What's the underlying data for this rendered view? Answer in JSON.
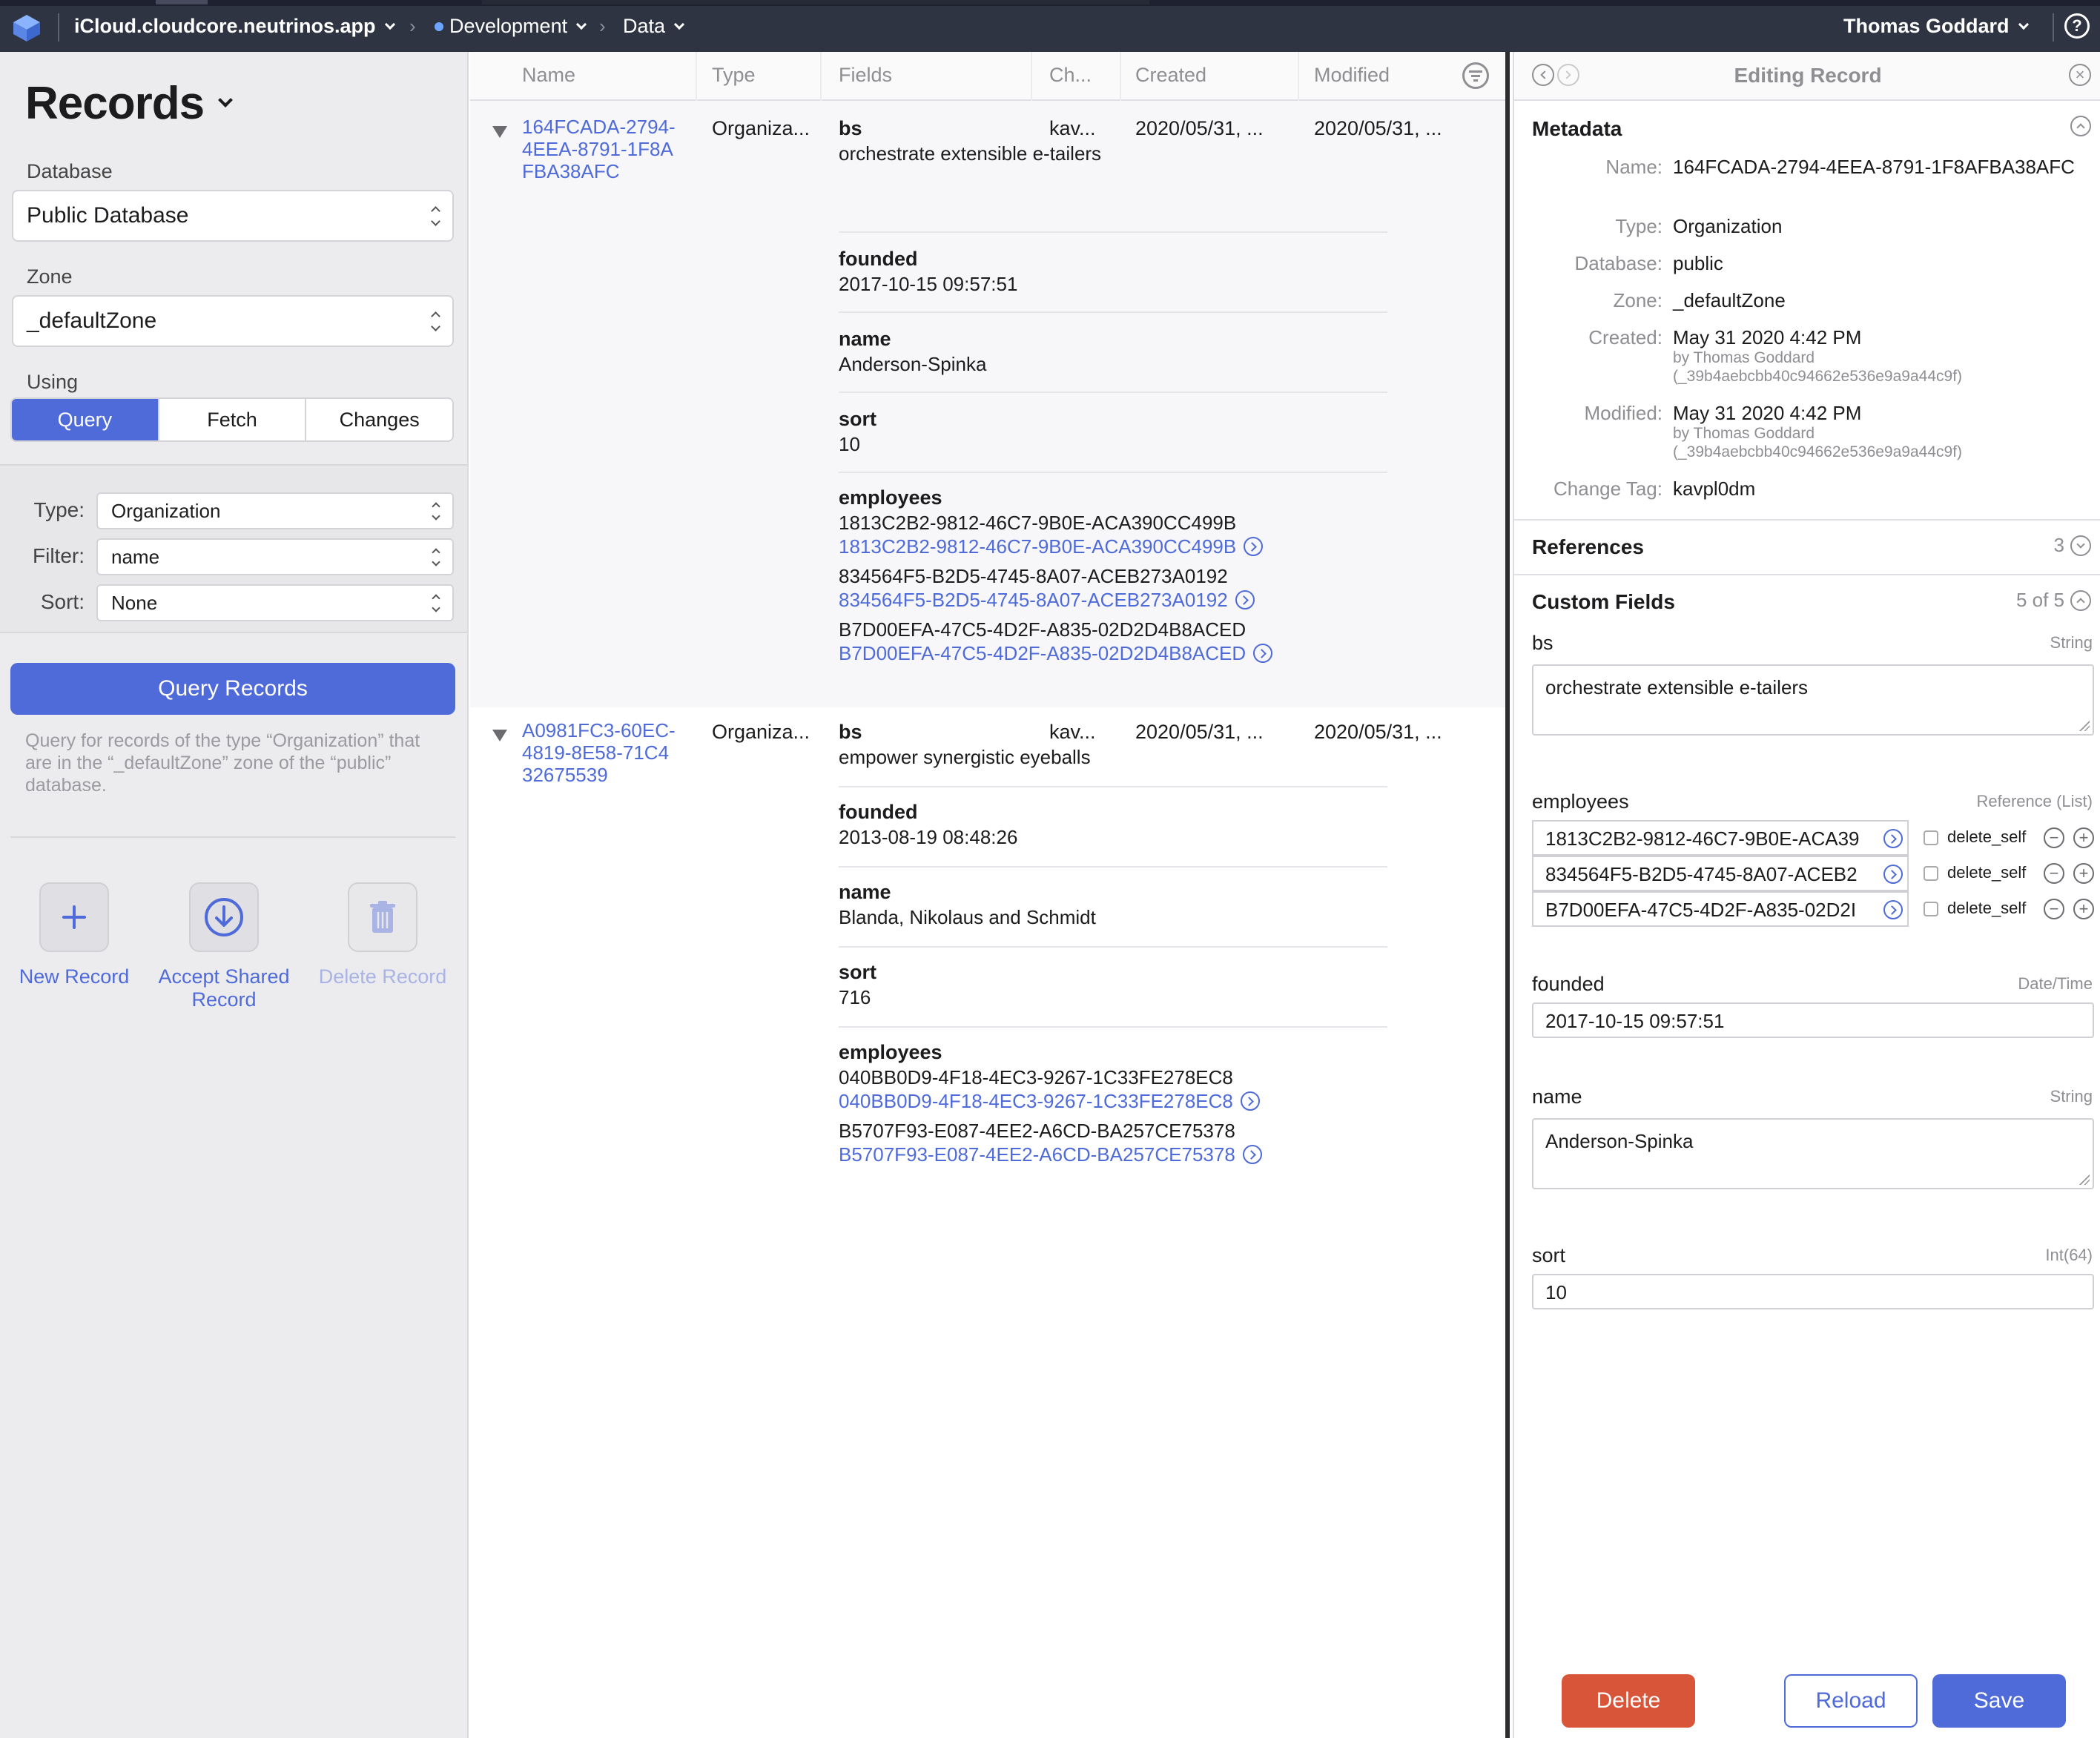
{
  "topbar": {
    "account": "iCloud.cloudcore.neutrinos.app",
    "environment": "Development",
    "section": "Data",
    "user": "Thomas Goddard",
    "help_icon": "?"
  },
  "sidebar": {
    "title": "Records",
    "database_label": "Database",
    "database_value": "Public Database",
    "zone_label": "Zone",
    "zone_value": "_defaultZone",
    "using_label": "Using",
    "modes": [
      "Query",
      "Fetch",
      "Changes"
    ],
    "active_mode": "Query",
    "type_label": "Type:",
    "type_value": "Organization",
    "filter_label": "Filter:",
    "filter_value": "name",
    "sort_label": "Sort:",
    "sort_value": "None",
    "query_button": "Query Records",
    "query_description": "Query for records of the type “Organization” that are in the “_defaultZone” zone of the “public” database.",
    "actions": {
      "new": "New Record",
      "accept": "Accept Shared Record",
      "delete": "Delete Record"
    },
    "accent_color": "#4f6ad9"
  },
  "table": {
    "columns": {
      "name": "Name",
      "type": "Type",
      "fields": "Fields",
      "change_tag": "Ch...",
      "created": "Created",
      "modified": "Modified"
    },
    "records": [
      {
        "name": "164FCADA-2794-4EEA-8791-1F8AFBA38AFC",
        "type": "Organiza...",
        "change_tag": "kav...",
        "created": "2020/05/31, ...",
        "modified": "2020/05/31, ...",
        "bs_label": "bs",
        "bs": "orchestrate extensible e-tailers",
        "founded_label": "founded",
        "founded": "2017-10-15 09:57:51",
        "name_label": "name",
        "name_value": "Anderson-Spinka",
        "sort_label": "sort",
        "sort": "10",
        "employees_label": "employees",
        "employees": [
          "1813C2B2-9812-46C7-9B0E-ACA390CC499B",
          "834564F5-B2D5-4745-8A07-ACEB273A0192",
          "B7D00EFA-47C5-4D2F-A835-02D2D4B8ACED"
        ]
      },
      {
        "name": "A0981FC3-60EC-4819-8E58-71C432675539",
        "type": "Organiza...",
        "change_tag": "kav...",
        "created": "2020/05/31, ...",
        "modified": "2020/05/31, ...",
        "bs_label": "bs",
        "bs": "empower synergistic eyeballs",
        "founded_label": "founded",
        "founded": "2013-08-19 08:48:26",
        "name_label": "name",
        "name_value": "Blanda, Nikolaus and Schmidt",
        "sort_label": "sort",
        "sort": "716",
        "employees_label": "employees",
        "employees": [
          "040BB0D9-4F18-4EC3-9267-1C33FE278EC8",
          "B5707F93-E087-4EE2-A6CD-BA257CE75378"
        ]
      }
    ]
  },
  "editor": {
    "title": "Editing Record",
    "metadata_title": "Metadata",
    "meta": {
      "name_label": "Name:",
      "name": "164FCADA-2794-4EEA-8791-1F8AFBA38AFC",
      "type_label": "Type:",
      "type": "Organization",
      "database_label": "Database:",
      "database": "public",
      "zone_label": "Zone:",
      "zone": "_defaultZone",
      "created_label": "Created:",
      "created": "May 31 2020 4:42 PM",
      "created_by": "by Thomas Goddard",
      "created_by_id": "(_39b4aebcbb40c94662e536e9a9a44c9f)",
      "modified_label": "Modified:",
      "modified": "May 31 2020 4:42 PM",
      "modified_by": "by Thomas Goddard",
      "modified_by_id": "(_39b4aebcbb40c94662e536e9a9a44c9f)",
      "change_tag_label": "Change Tag:",
      "change_tag": "kavpl0dm"
    },
    "references_title": "References",
    "references_count": "3",
    "custom_fields_title": "Custom Fields",
    "custom_fields_count": "5 of 5",
    "fields": {
      "bs_label": "bs",
      "bs_type": "String",
      "bs_value": "orchestrate extensible e-tailers",
      "employees_label": "employees",
      "employees_type": "Reference (List)",
      "employees": [
        {
          "value": "1813C2B2-9812-46C7-9B0E-ACA39",
          "action": "delete_self",
          "index": "0"
        },
        {
          "value": "834564F5-B2D5-4745-8A07-ACEB2",
          "action": "delete_self",
          "index": "1"
        },
        {
          "value": "B7D00EFA-47C5-4D2F-A835-02D2I",
          "action": "delete_self",
          "index": "2"
        }
      ],
      "founded_label": "founded",
      "founded_type": "Date/Time",
      "founded_value": "2017-10-15 09:57:51",
      "name_label": "name",
      "name_type": "String",
      "name_value": "Anderson-Spinka",
      "sort_label": "sort",
      "sort_type": "Int(64)",
      "sort_value": "10"
    },
    "buttons": {
      "delete": "Delete",
      "reload": "Reload",
      "save": "Save"
    },
    "danger_color": "#d9553a"
  }
}
